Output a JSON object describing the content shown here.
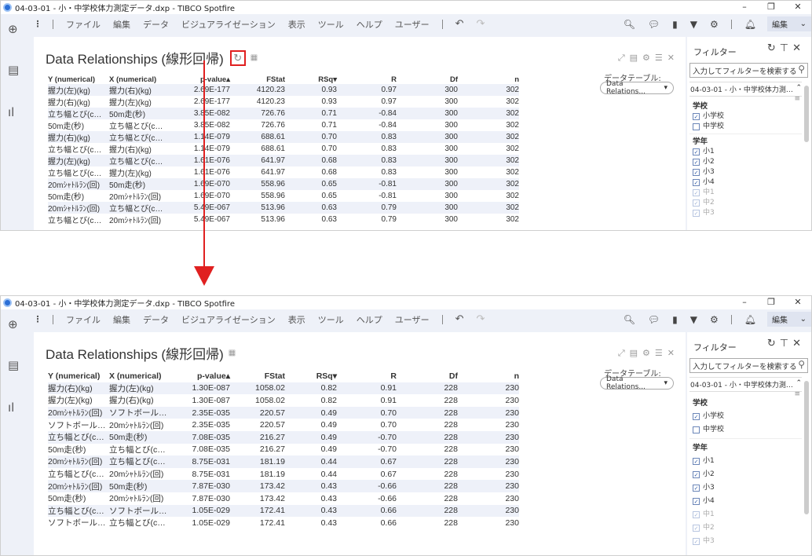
{
  "shot1": {
    "window_title": "04-03-01 - 小・中学校体力測定データ.dxp - TIBCO Spotfire",
    "rows": [
      [
        "握力(左)(kg)",
        "握力(右)(kg)",
        "2.69E-177",
        "4120.23",
        "0.93",
        "0.97",
        "300",
        "302"
      ],
      [
        "握力(右)(kg)",
        "握力(左)(kg)",
        "2.69E-177",
        "4120.23",
        "0.93",
        "0.97",
        "300",
        "302"
      ],
      [
        "立ち幅とび(c…",
        "50m走(秒)",
        "3.85E-082",
        "726.76",
        "0.71",
        "-0.84",
        "300",
        "302"
      ],
      [
        "50m走(秒)",
        "立ち幅とび(c…",
        "3.85E-082",
        "726.76",
        "0.71",
        "-0.84",
        "300",
        "302"
      ],
      [
        "握力(右)(kg)",
        "立ち幅とび(c…",
        "1.14E-079",
        "688.61",
        "0.70",
        "0.83",
        "300",
        "302"
      ],
      [
        "立ち幅とび(c…",
        "握力(右)(kg)",
        "1.14E-079",
        "688.61",
        "0.70",
        "0.83",
        "300",
        "302"
      ],
      [
        "握力(左)(kg)",
        "立ち幅とび(c…",
        "1.61E-076",
        "641.97",
        "0.68",
        "0.83",
        "300",
        "302"
      ],
      [
        "立ち幅とび(c…",
        "握力(左)(kg)",
        "1.61E-076",
        "641.97",
        "0.68",
        "0.83",
        "300",
        "302"
      ],
      [
        "20mｼｬﾄﾙﾗﾝ(回)",
        "50m走(秒)",
        "1.69E-070",
        "558.96",
        "0.65",
        "-0.81",
        "300",
        "302"
      ],
      [
        "50m走(秒)",
        "20mｼｬﾄﾙﾗﾝ(回)",
        "1.69E-070",
        "558.96",
        "0.65",
        "-0.81",
        "300",
        "302"
      ],
      [
        "20mｼｬﾄﾙﾗﾝ(回)",
        "立ち幅とび(c…",
        "5.49E-067",
        "513.96",
        "0.63",
        "0.79",
        "300",
        "302"
      ],
      [
        "立ち幅とび(c…",
        "20mｼｬﾄﾙﾗﾝ(回)",
        "5.49E-067",
        "513.96",
        "0.63",
        "0.79",
        "300",
        "302"
      ]
    ]
  },
  "shot2": {
    "window_title": "04-03-01 - 小・中学校体力測定データ.dxp - TIBCO Spotfire",
    "rows": [
      [
        "握力(右)(kg)",
        "握力(左)(kg)",
        "1.30E-087",
        "1058.02",
        "0.82",
        "0.91",
        "228",
        "230"
      ],
      [
        "握力(左)(kg)",
        "握力(右)(kg)",
        "1.30E-087",
        "1058.02",
        "0.82",
        "0.91",
        "228",
        "230"
      ],
      [
        "20mｼｬﾄﾙﾗﾝ(回)",
        "ソフトボール…",
        "2.35E-035",
        "220.57",
        "0.49",
        "0.70",
        "228",
        "230"
      ],
      [
        "ソフトボール…",
        "20mｼｬﾄﾙﾗﾝ(回)",
        "2.35E-035",
        "220.57",
        "0.49",
        "0.70",
        "228",
        "230"
      ],
      [
        "立ち幅とび(c…",
        "50m走(秒)",
        "7.08E-035",
        "216.27",
        "0.49",
        "-0.70",
        "228",
        "230"
      ],
      [
        "50m走(秒)",
        "立ち幅とび(c…",
        "7.08E-035",
        "216.27",
        "0.49",
        "-0.70",
        "228",
        "230"
      ],
      [
        "20mｼｬﾄﾙﾗﾝ(回)",
        "立ち幅とび(c…",
        "8.75E-031",
        "181.19",
        "0.44",
        "0.67",
        "228",
        "230"
      ],
      [
        "立ち幅とび(c…",
        "20mｼｬﾄﾙﾗﾝ(回)",
        "8.75E-031",
        "181.19",
        "0.44",
        "0.67",
        "228",
        "230"
      ],
      [
        "20mｼｬﾄﾙﾗﾝ(回)",
        "50m走(秒)",
        "7.87E-030",
        "173.42",
        "0.43",
        "-0.66",
        "228",
        "230"
      ],
      [
        "50m走(秒)",
        "20mｼｬﾄﾙﾗﾝ(回)",
        "7.87E-030",
        "173.42",
        "0.43",
        "-0.66",
        "228",
        "230"
      ],
      [
        "立ち幅とび(c…",
        "ソフトボール…",
        "1.05E-029",
        "172.41",
        "0.43",
        "0.66",
        "228",
        "230"
      ],
      [
        "ソフトボール…",
        "立ち幅とび(c…",
        "1.05E-029",
        "172.41",
        "0.43",
        "0.66",
        "228",
        "230"
      ]
    ]
  },
  "common": {
    "window_controls": [
      "–",
      "❐",
      "✕"
    ],
    "menu": [
      "ファイル",
      "編集",
      "データ",
      "ビジュアライゼーション",
      "表示",
      "ツール",
      "ヘルプ",
      "ユーザー"
    ],
    "edit_button": "編集",
    "viz_title": "Data Relationships (線形回帰)",
    "columns": [
      "Y (numerical)",
      "X (numerical)",
      "p-value",
      "FStat",
      "RSq",
      "R",
      "Df",
      "n"
    ],
    "sort_asc": "▴",
    "sort_desc": "▾",
    "data_table_label": "データテーブル:",
    "data_table_value": "Data Relations...",
    "filter_title": "フィルター",
    "filter_search_placeholder": "入力してフィルターを検索する",
    "filter_group_title": "04-03-01 - 小・中学校体力測…",
    "filter_school_label": "学校",
    "filter_school_items": [
      "小学校",
      "中学校"
    ],
    "filter_school_checked": [
      true,
      false
    ],
    "filter_grade_label": "学年",
    "filter_grade_items": [
      "小1",
      "小2",
      "小3",
      "小4",
      "中1",
      "中2",
      "中3"
    ],
    "colors": {
      "highlight": "#e02020",
      "toolbar_bg": "#eef1f8",
      "row_stripe": "#eef1f9"
    }
  }
}
